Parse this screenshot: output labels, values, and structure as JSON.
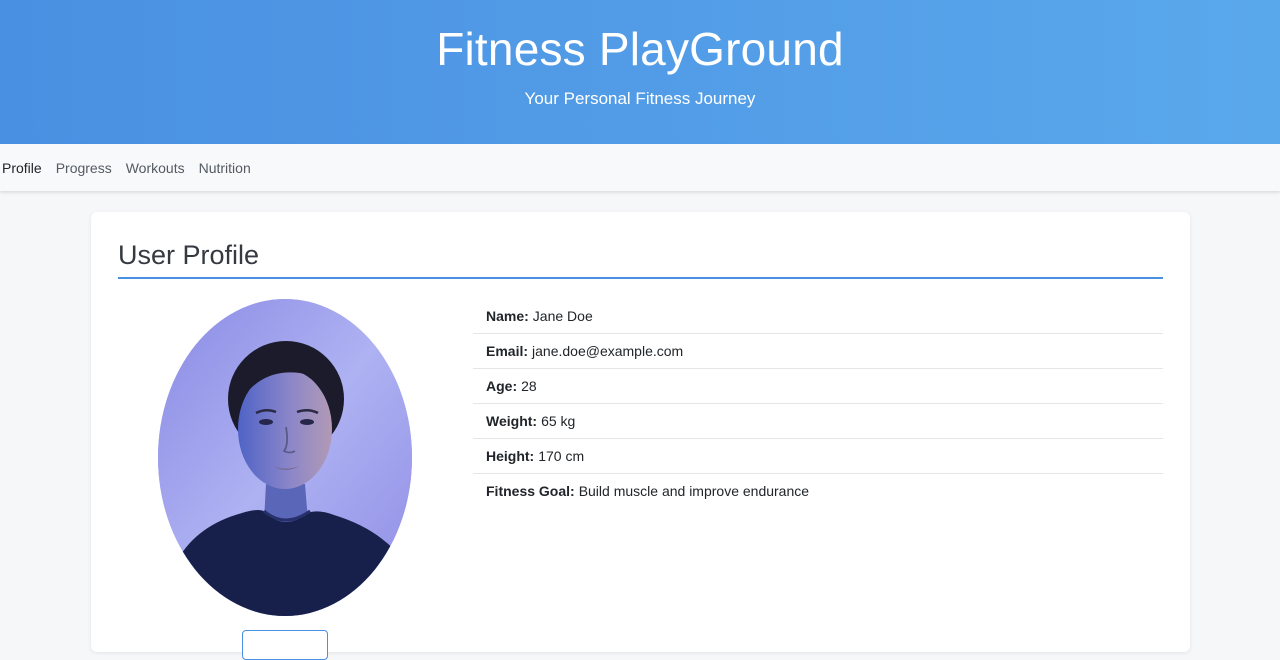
{
  "header": {
    "title": "Fitness PlayGround",
    "subtitle": "Your Personal Fitness Journey"
  },
  "nav": {
    "items": [
      {
        "label": "Profile"
      },
      {
        "label": "Progress"
      },
      {
        "label": "Workouts"
      },
      {
        "label": "Nutrition"
      }
    ]
  },
  "profile": {
    "title": "User Profile",
    "avatar_icon": "user-photo",
    "fields": [
      {
        "label": "Name:",
        "value": "Jane Doe"
      },
      {
        "label": "Email:",
        "value": "jane.doe@example.com"
      },
      {
        "label": "Age:",
        "value": "28"
      },
      {
        "label": "Weight:",
        "value": "65 kg"
      },
      {
        "label": "Height:",
        "value": "170 cm"
      },
      {
        "label": "Fitness Goal:",
        "value": "Build muscle and improve endurance"
      }
    ]
  },
  "colors": {
    "accent": "#4a90e2",
    "header_gradient_end": "#5aa8ec",
    "background": "#f6f7f9"
  }
}
